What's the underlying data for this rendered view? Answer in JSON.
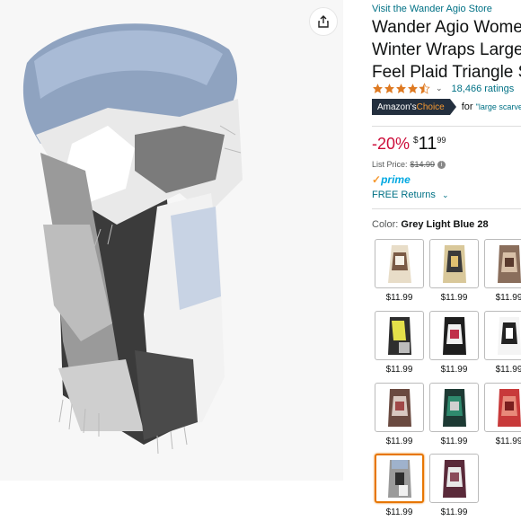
{
  "store_link": "Visit the Wander Agio Store",
  "title_lines": [
    "Wander Agio Women",
    "Winter Wraps Large",
    "Feel Plaid Triangle S"
  ],
  "rating": {
    "stars": 4.5,
    "count_text": "18,466 ratings"
  },
  "choice": {
    "badge_prefix": "Amazon's ",
    "badge_suffix": "Choice",
    "for_label": "for",
    "query": "\"large scarves"
  },
  "price": {
    "discount": "-20%",
    "currency": "$",
    "whole": "11",
    "fraction": "99"
  },
  "list_price": {
    "label": "List Price:",
    "value": "$14.99"
  },
  "prime": {
    "check": "✓",
    "word": "prime"
  },
  "free_returns": "FREE Returns",
  "color": {
    "label": "Color:",
    "selected": "Grey Light Blue 28"
  },
  "swatches": [
    {
      "price": "$11.99"
    },
    {
      "price": "$11.99"
    },
    {
      "price": "$11.99"
    },
    {
      "price": "$11.99"
    },
    {
      "price": "$11.99"
    },
    {
      "price": "$11.99"
    },
    {
      "price": "$11.99"
    },
    {
      "price": "$11.99"
    },
    {
      "price": "$11.99"
    },
    {
      "price": "$11.99"
    },
    {
      "price": "$11.99"
    }
  ],
  "colors": {
    "link": "#007185",
    "discount": "#cc0c39",
    "badge": "#232f3e",
    "accent": "#f69931",
    "prime": "#00a8e1"
  }
}
